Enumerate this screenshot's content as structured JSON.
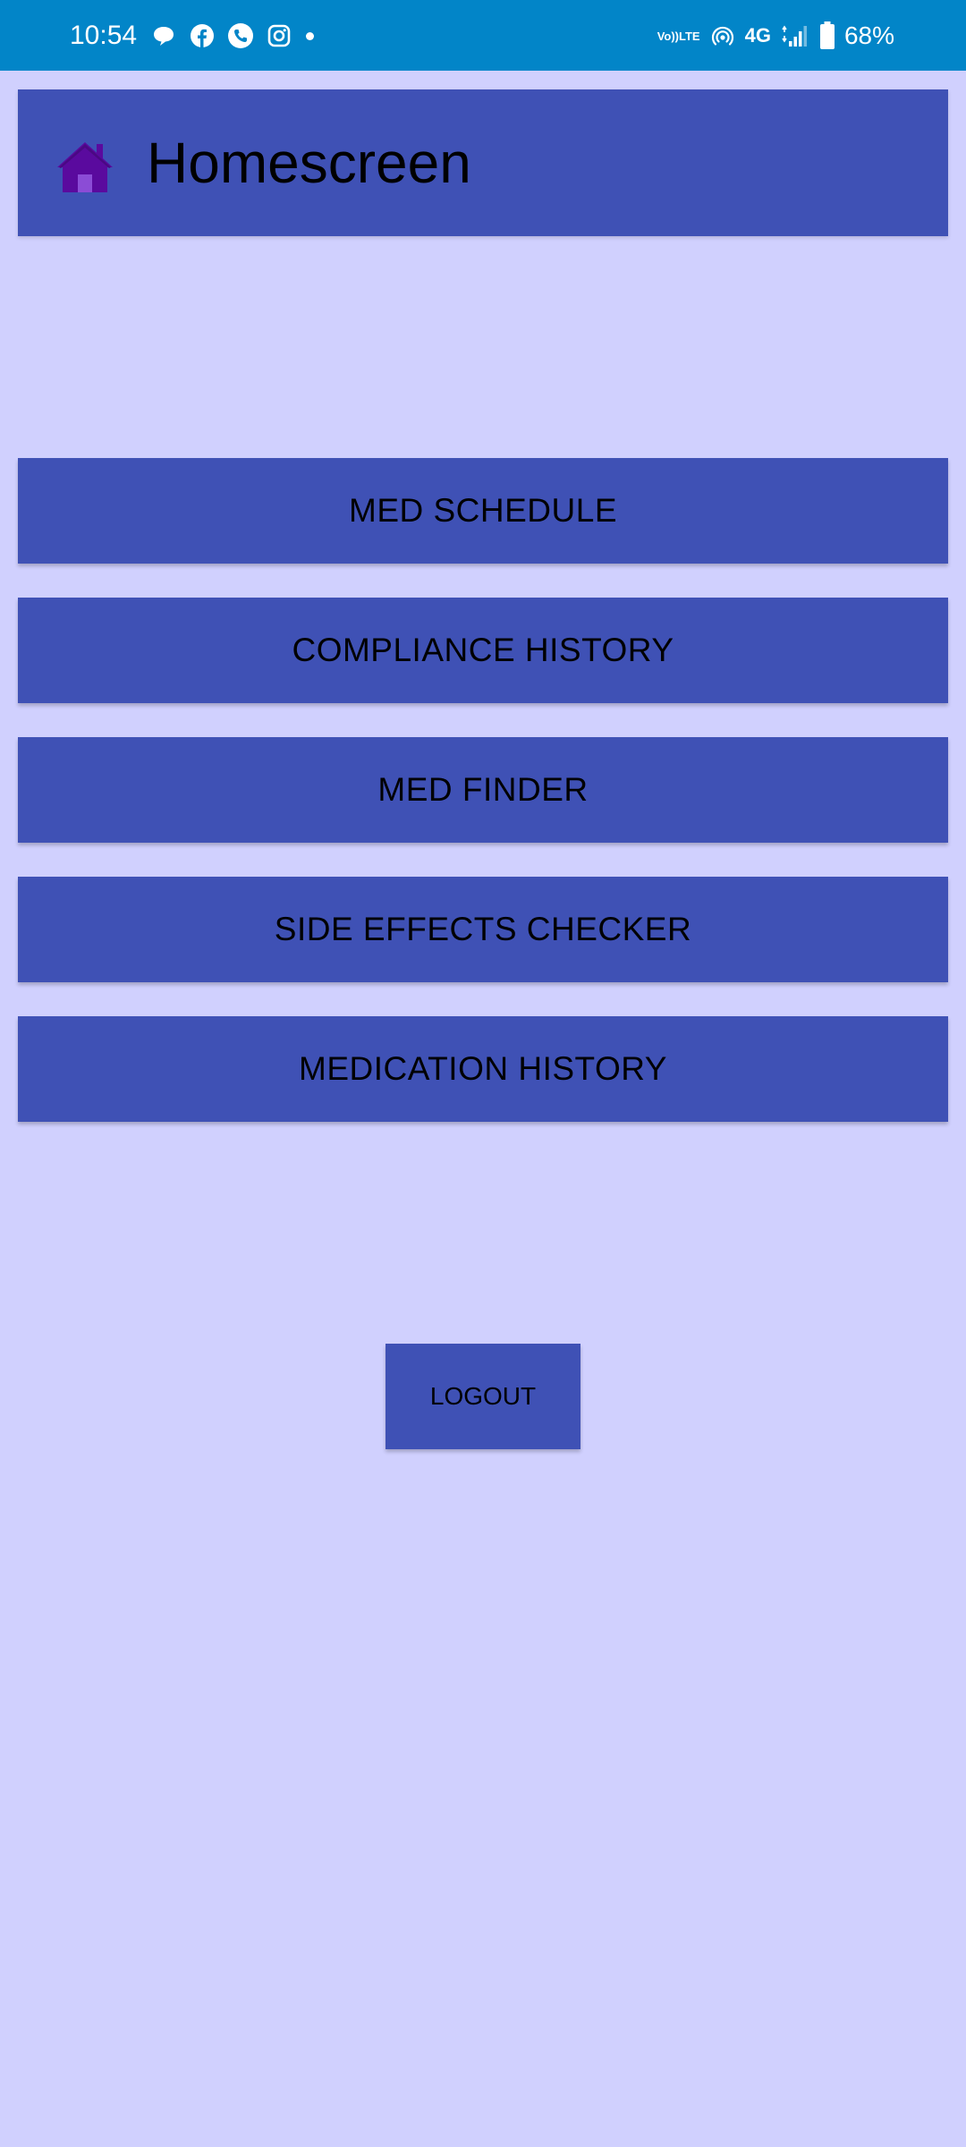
{
  "status_bar": {
    "time": "10:54",
    "left_icons": [
      "chat-bubble-icon",
      "facebook-icon",
      "phone-call-icon",
      "instagram-icon",
      "more-dot-icon"
    ],
    "volte_top": "Vo))",
    "volte_bottom": "LTE",
    "network_type": "4G",
    "battery": "68%"
  },
  "header": {
    "icon": "home-icon",
    "title": "Homescreen"
  },
  "menu": {
    "buttons": [
      {
        "label": "MED SCHEDULE"
      },
      {
        "label": "COMPLIANCE HISTORY"
      },
      {
        "label": "MED FINDER"
      },
      {
        "label": "SIDE EFFECTS CHECKER"
      },
      {
        "label": "MEDICATION HISTORY"
      }
    ]
  },
  "logout": {
    "label": "LOGOUT"
  },
  "colors": {
    "status_bar": "#0285c8",
    "background": "#d0d0fe",
    "button": "#3f51b5",
    "home_icon": "#5a0a9e"
  }
}
